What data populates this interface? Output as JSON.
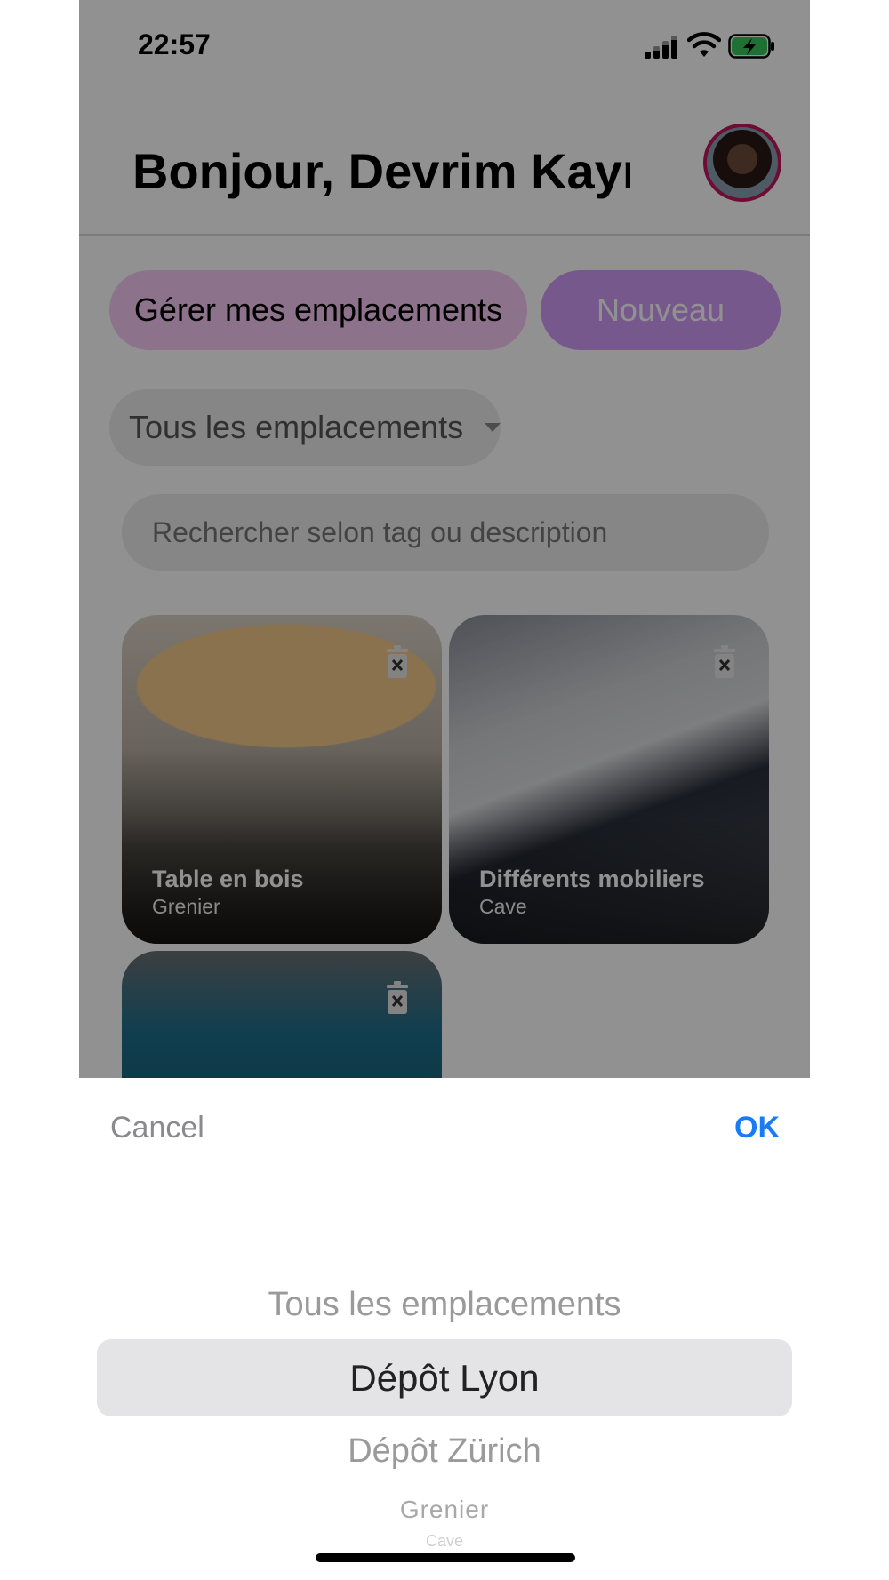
{
  "status_bar": {
    "time": "22:57"
  },
  "header": {
    "greeting": "Bonjour, Devrim Kayn"
  },
  "actions": {
    "manage_label": "Gérer mes emplacements",
    "new_label": "Nouveau"
  },
  "filter": {
    "selected": "Tous les emplacements"
  },
  "search": {
    "placeholder": "Rechercher selon tag ou description"
  },
  "items": [
    {
      "title": "Table en bois",
      "location": "Grenier"
    },
    {
      "title": "Différents mobiliers",
      "location": "Cave"
    },
    {
      "title": "",
      "location": ""
    }
  ],
  "picker": {
    "cancel_label": "Cancel",
    "ok_label": "OK",
    "options": [
      "Tous les emplacements",
      "Dépôt Lyon",
      "Dépôt Zürich",
      "Grenier",
      "Cave"
    ],
    "selected_index": 1
  },
  "colors": {
    "manage_button_bg": "#f7c8f2",
    "new_button_bg": "#cf9cf6",
    "ok_blue": "#1a7cf5",
    "avatar_ring": "#c2185b"
  },
  "icons": [
    "signal-icon",
    "wifi-icon",
    "battery-charging-icon",
    "trash-icon"
  ]
}
